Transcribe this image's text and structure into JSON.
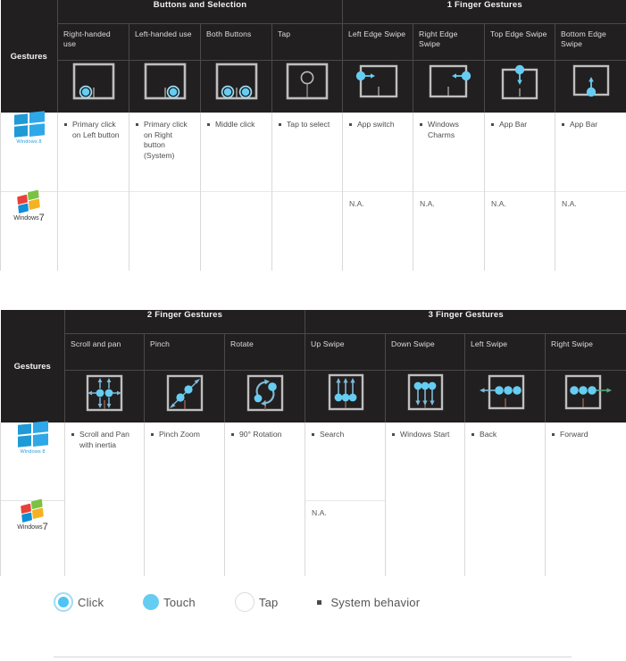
{
  "row_header_label": "Gestures",
  "os_rows": [
    {
      "name": "Windows 8",
      "logo": "windows-8-logo",
      "wordmark": "Windows 8"
    },
    {
      "name": "Windows 7",
      "logo": "windows-7-logo",
      "wordmark": "Windows",
      "wordmark_num": "7"
    }
  ],
  "table1": {
    "groups": [
      {
        "label": "Buttons and Selection",
        "span": 4
      },
      {
        "label": "1 Finger Gestures",
        "span": 4
      }
    ],
    "columns": [
      {
        "label": "Right-handed use",
        "icon": "touchpad-left-button-click-icon"
      },
      {
        "label": "Left-handed use",
        "icon": "touchpad-right-button-click-icon"
      },
      {
        "label": "Both Buttons",
        "icon": "touchpad-both-buttons-click-icon"
      },
      {
        "label": "Tap",
        "icon": "touchpad-tap-icon"
      },
      {
        "label": "Left Edge Swipe",
        "icon": "touchpad-left-edge-swipe-icon"
      },
      {
        "label": "Right Edge Swipe",
        "icon": "touchpad-right-edge-swipe-icon"
      },
      {
        "label": "Top Edge Swipe",
        "icon": "touchpad-top-edge-swipe-icon"
      },
      {
        "label": "Bottom Edge Swipe",
        "icon": "touchpad-bottom-edge-swipe-icon"
      }
    ],
    "windows8": [
      [
        "Primary click on Left button"
      ],
      [
        "Primary click on Right button (System)"
      ],
      [
        "Middle click"
      ],
      [
        "Tap to select"
      ],
      [
        "App switch"
      ],
      [
        "Windows Charms"
      ],
      [
        "App Bar"
      ],
      [
        "App Bar"
      ]
    ],
    "windows7": [
      "",
      "",
      "",
      "",
      "N.A.",
      "N.A.",
      "N.A.",
      "N.A."
    ]
  },
  "table2": {
    "groups": [
      {
        "label": "2 Finger Gestures",
        "span": 3
      },
      {
        "label": "3 Finger Gestures",
        "span": 4
      }
    ],
    "columns": [
      {
        "label": "Scroll and pan",
        "icon": "two-finger-scroll-pan-icon"
      },
      {
        "label": "Pinch",
        "icon": "two-finger-pinch-icon"
      },
      {
        "label": "Rotate",
        "icon": "two-finger-rotate-icon"
      },
      {
        "label": "Up Swipe",
        "icon": "three-finger-up-swipe-icon"
      },
      {
        "label": "Down Swipe",
        "icon": "three-finger-down-swipe-icon"
      },
      {
        "label": "Left Swipe",
        "icon": "three-finger-left-swipe-icon"
      },
      {
        "label": "Right Swipe",
        "icon": "three-finger-right-swipe-icon"
      }
    ],
    "windows8": [
      [
        "Scroll and Pan with inertia"
      ],
      [
        "Pinch Zoom"
      ],
      [
        "90° Rotation"
      ],
      [
        "Search"
      ],
      [
        "Windows Start"
      ],
      [
        "Back"
      ],
      [
        "Forward"
      ]
    ],
    "windows7": [
      "",
      "",
      "",
      "N.A.",
      "",
      "",
      ""
    ]
  },
  "legend": [
    {
      "label": "Click",
      "icon": "click-ring-icon"
    },
    {
      "label": "Touch",
      "icon": "touch-dot-icon"
    },
    {
      "label": "Tap",
      "icon": "tap-outline-icon"
    },
    {
      "label": "System behavior",
      "icon": "system-behavior-square-icon"
    }
  ],
  "colors": {
    "accent": "#4fc3f2",
    "dark_bg": "#211f1f",
    "touchpad_border": "#bfbfbf",
    "win8_blue": "#2d9cdb"
  }
}
